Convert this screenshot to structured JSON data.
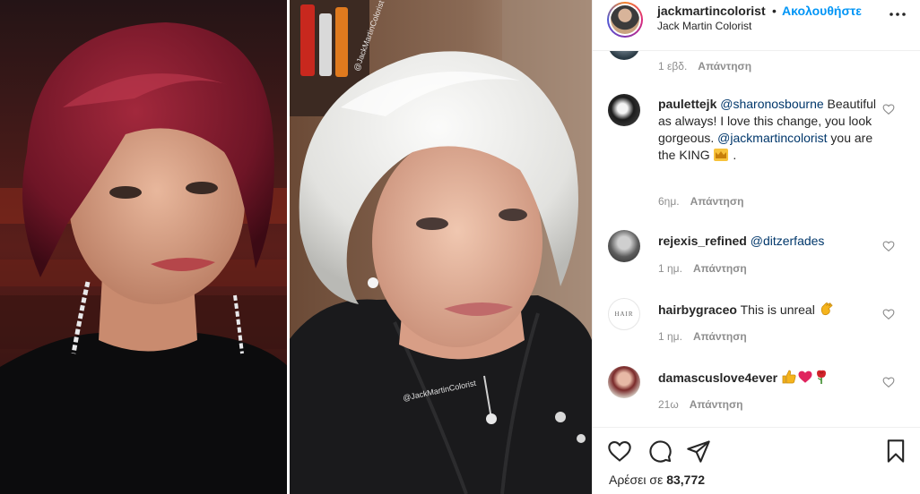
{
  "post": {
    "username": "jackmartincolorist",
    "dot": "•",
    "follow_label": "Ακολουθήστε",
    "subtitle": "Jack Martin Colorist",
    "watermark_top": "@JackMartinColorist",
    "watermark_bottom": "@JackMartinColorist"
  },
  "comments": {
    "prev_meta": {
      "time": "1 εβδ.",
      "reply": "Απάντηση"
    },
    "items": [
      {
        "user": "paulettejk",
        "mention1": "@sharonosbourne",
        "text1": "Beautiful as always! I love this change, you look gorgeous.",
        "mention2": "@jackmartincolorist",
        "text2": "you are the KING",
        "emoji": "crown",
        "tail": ".",
        "time": "6ημ.",
        "reply": "Απάντηση"
      },
      {
        "user": "rejexis_refined",
        "mention1": "@ditzerfades",
        "time": "1 ημ.",
        "reply": "Απάντηση"
      },
      {
        "user": "hairbygraceo",
        "text1": "This is unreal",
        "emoji": "clapping-hands",
        "avatar_text": "HAIR",
        "time": "1 ημ.",
        "reply": "Απάντηση"
      },
      {
        "user": "damascuslove4ever",
        "emoji": "thumbs-up, heart, rose",
        "time": "21ω",
        "reply": "Απάντηση"
      }
    ]
  },
  "actions": {
    "likes_label": "Αρέσει σε",
    "likes_count": "83,772"
  },
  "colors": {
    "accent_blue": "#0095f6",
    "mention_blue": "#00376b",
    "meta_gray": "#8e8e8e",
    "text": "#262626",
    "hair_left": "#7a1c2e",
    "hair_right": "#e4e4e2"
  }
}
